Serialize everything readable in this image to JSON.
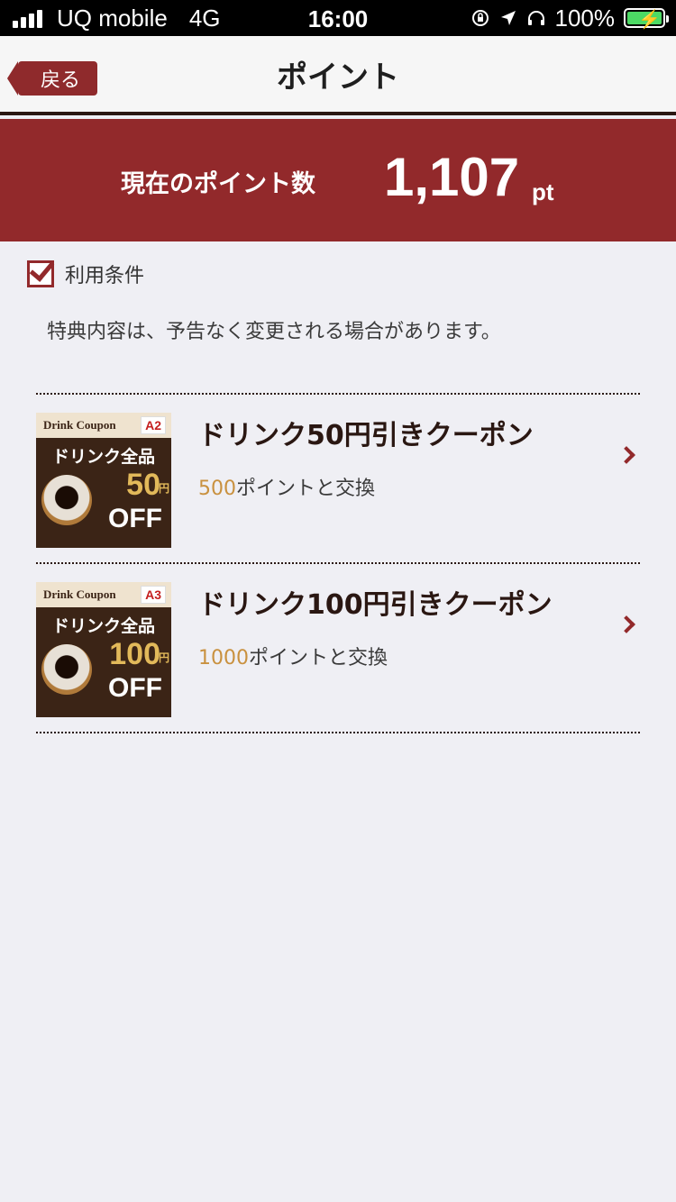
{
  "status_bar": {
    "carrier": "UQ mobile",
    "network": "4G",
    "time": "16:00",
    "battery": "100%"
  },
  "nav": {
    "back_label": "戻る",
    "title": "ポイント"
  },
  "points": {
    "label": "現在のポイント数",
    "value": "1,107",
    "unit": "pt"
  },
  "terms": {
    "title": "利用条件",
    "notice": "特典内容は、予告なく変更される場合があります。"
  },
  "coupons": [
    {
      "thumb_brand": "Drink Coupon",
      "thumb_code": "A2",
      "thumb_headline": "ドリンク全品",
      "thumb_amount": "50",
      "thumb_yen": "円",
      "thumb_off": "OFF",
      "name": "ドリンク50円引きクーポン",
      "cost_points": "500",
      "cost_suffix": "ポイントと交換"
    },
    {
      "thumb_brand": "Drink Coupon",
      "thumb_code": "A3",
      "thumb_headline": "ドリンク全品",
      "thumb_amount": "100",
      "thumb_yen": "円",
      "thumb_off": "OFF",
      "name": "ドリンク100円引きクーポン",
      "cost_points": "1000",
      "cost_suffix": "ポイントと交換"
    }
  ],
  "colors": {
    "accent": "#92292b",
    "cost_highlight": "#c9913f",
    "background": "#efeff4"
  }
}
